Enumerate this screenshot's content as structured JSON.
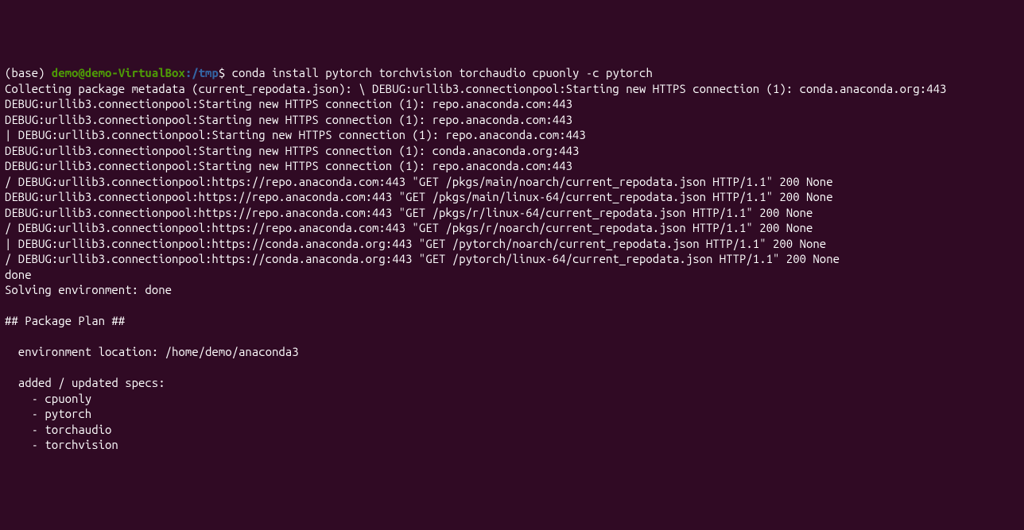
{
  "prompt": {
    "env": "(base) ",
    "user": "demo@demo-VirtualBox",
    "colon": ":",
    "path": "/tmp",
    "dollar": "$ "
  },
  "command": "conda install pytorch torchvision torchaudio cpuonly -c pytorch",
  "output_lines": [
    "Collecting package metadata (current_repodata.json): \\ DEBUG:urllib3.connectionpool:Starting new HTTPS connection (1): conda.anaconda.org:443",
    "DEBUG:urllib3.connectionpool:Starting new HTTPS connection (1): repo.anaconda.com:443",
    "DEBUG:urllib3.connectionpool:Starting new HTTPS connection (1): repo.anaconda.com:443",
    "| DEBUG:urllib3.connectionpool:Starting new HTTPS connection (1): repo.anaconda.com:443",
    "DEBUG:urllib3.connectionpool:Starting new HTTPS connection (1): conda.anaconda.org:443",
    "DEBUG:urllib3.connectionpool:Starting new HTTPS connection (1): repo.anaconda.com:443",
    "/ DEBUG:urllib3.connectionpool:https://repo.anaconda.com:443 \"GET /pkgs/main/noarch/current_repodata.json HTTP/1.1\" 200 None",
    "DEBUG:urllib3.connectionpool:https://repo.anaconda.com:443 \"GET /pkgs/main/linux-64/current_repodata.json HTTP/1.1\" 200 None",
    "DEBUG:urllib3.connectionpool:https://repo.anaconda.com:443 \"GET /pkgs/r/linux-64/current_repodata.json HTTP/1.1\" 200 None",
    "/ DEBUG:urllib3.connectionpool:https://repo.anaconda.com:443 \"GET /pkgs/r/noarch/current_repodata.json HTTP/1.1\" 200 None",
    "| DEBUG:urllib3.connectionpool:https://conda.anaconda.org:443 \"GET /pytorch/noarch/current_repodata.json HTTP/1.1\" 200 None",
    "/ DEBUG:urllib3.connectionpool:https://conda.anaconda.org:443 \"GET /pytorch/linux-64/current_repodata.json HTTP/1.1\" 200 None",
    "done",
    "Solving environment: done",
    "",
    "## Package Plan ##",
    "",
    "  environment location: /home/demo/anaconda3",
    "",
    "  added / updated specs:",
    "    - cpuonly",
    "    - pytorch",
    "    - torchaudio",
    "    - torchvision"
  ]
}
